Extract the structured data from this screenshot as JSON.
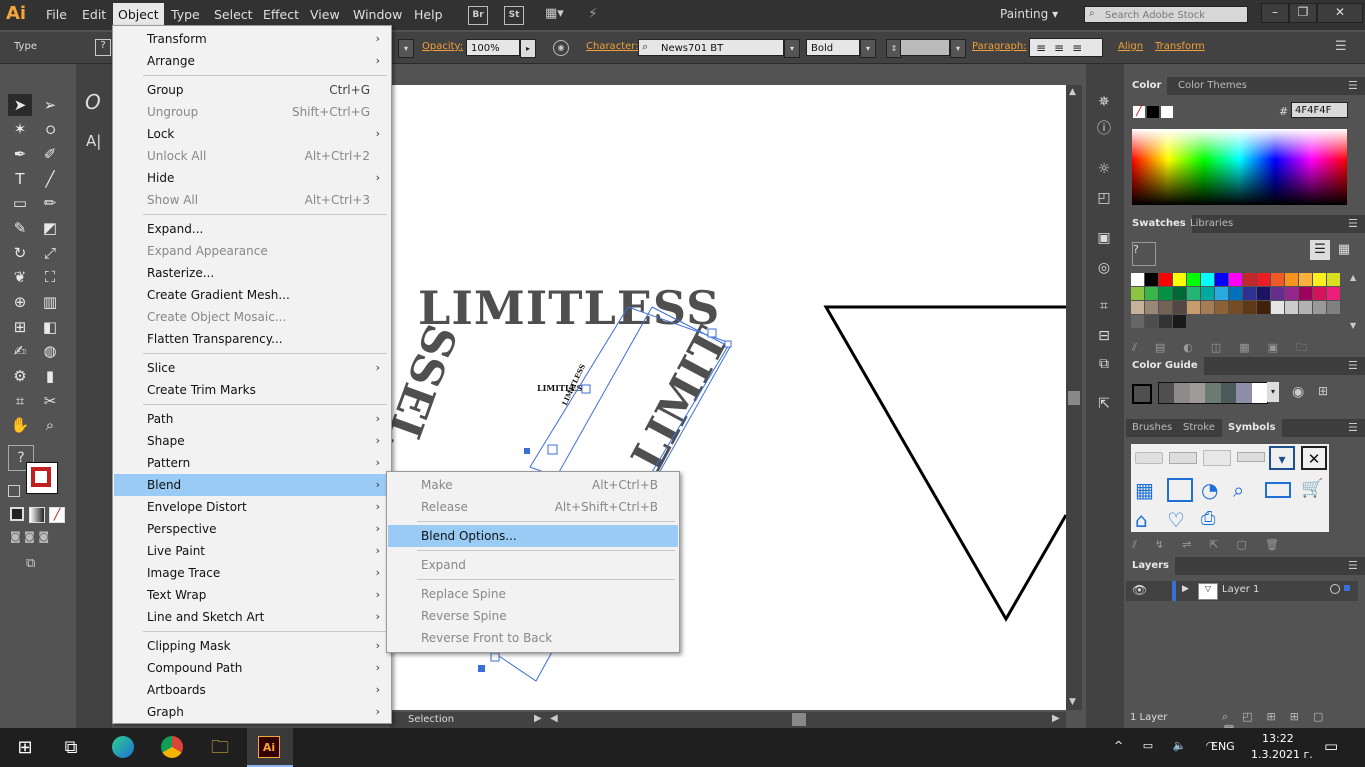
{
  "app": {
    "logo": "Ai",
    "workspace": "Painting",
    "search_placeholder": "Search Adobe Stock"
  },
  "menubar": [
    "File",
    "Edit",
    "Object",
    "Type",
    "Select",
    "Effect",
    "View",
    "Window",
    "Help"
  ],
  "menubar_icons": {
    "br": "Br",
    "st": "St"
  },
  "controlbar": {
    "tool_label": "Type",
    "opacity_label": "Opacity:",
    "opacity_value": "100%",
    "character_label": "Character:",
    "font_value": "News701 BT",
    "style_value": "Bold",
    "paragraph_label": "Paragraph:",
    "align_label": "Align",
    "transform_label": "Transform"
  },
  "object_menu": [
    {
      "label": "Transform",
      "submenu": true
    },
    {
      "label": "Arrange",
      "submenu": true
    },
    {
      "sep": true
    },
    {
      "label": "Group",
      "shortcut": "Ctrl+G"
    },
    {
      "label": "Ungroup",
      "shortcut": "Shift+Ctrl+G",
      "disabled": true
    },
    {
      "label": "Lock",
      "submenu": true
    },
    {
      "label": "Unlock All",
      "shortcut": "Alt+Ctrl+2",
      "disabled": true
    },
    {
      "label": "Hide",
      "submenu": true
    },
    {
      "label": "Show All",
      "shortcut": "Alt+Ctrl+3",
      "disabled": true
    },
    {
      "sep": true
    },
    {
      "label": "Expand..."
    },
    {
      "label": "Expand Appearance",
      "disabled": true
    },
    {
      "label": "Rasterize..."
    },
    {
      "label": "Create Gradient Mesh..."
    },
    {
      "label": "Create Object Mosaic...",
      "disabled": true
    },
    {
      "label": "Flatten Transparency..."
    },
    {
      "sep": true
    },
    {
      "label": "Slice",
      "submenu": true
    },
    {
      "label": "Create Trim Marks"
    },
    {
      "sep": true
    },
    {
      "label": "Path",
      "submenu": true
    },
    {
      "label": "Shape",
      "submenu": true
    },
    {
      "label": "Pattern",
      "submenu": true
    },
    {
      "label": "Blend",
      "submenu": true,
      "highlight": true
    },
    {
      "label": "Envelope Distort",
      "submenu": true
    },
    {
      "label": "Perspective",
      "submenu": true
    },
    {
      "label": "Live Paint",
      "submenu": true
    },
    {
      "label": "Image Trace",
      "submenu": true
    },
    {
      "label": "Text Wrap",
      "submenu": true
    },
    {
      "label": "Line and Sketch Art",
      "submenu": true
    },
    {
      "sep": true
    },
    {
      "label": "Clipping Mask",
      "submenu": true
    },
    {
      "label": "Compound Path",
      "submenu": true
    },
    {
      "label": "Artboards",
      "submenu": true
    },
    {
      "label": "Graph",
      "submenu": true
    }
  ],
  "blend_submenu": [
    {
      "label": "Make",
      "shortcut": "Alt+Ctrl+B",
      "disabled": true
    },
    {
      "label": "Release",
      "shortcut": "Alt+Shift+Ctrl+B",
      "disabled": true
    },
    {
      "sep": true
    },
    {
      "label": "Blend Options...",
      "highlight": true
    },
    {
      "sep": true
    },
    {
      "label": "Expand",
      "disabled": true
    },
    {
      "sep": true
    },
    {
      "label": "Replace Spine",
      "disabled": true
    },
    {
      "label": "Reverse Spine",
      "disabled": true
    },
    {
      "label": "Reverse Front to Back",
      "disabled": true
    }
  ],
  "artwork": {
    "text_main": "LIMITLESS",
    "text_rot_left": "SSEL",
    "text_rot_right": "LIMIT",
    "text_small": "LIMITLESS",
    "text_small_rot": "LIMITLESS"
  },
  "status": {
    "tool": "Selection"
  },
  "panels": {
    "color_tabs": [
      "Color",
      "Color Themes"
    ],
    "color_hex_label": "#",
    "color_hex": "4F4F4F",
    "swatch_tabs": [
      "Swatches",
      "Libraries"
    ],
    "color_guide_tab": "Color Guide",
    "symbol_tabs": [
      "Brushes",
      "Stroke",
      "Symbols"
    ],
    "layers_tab": "Layers",
    "layer_name": "Layer 1",
    "layers_count": "1 Layer"
  },
  "swatch_colors": [
    "#ffffff",
    "#000000",
    "#ff0000",
    "#ffff00",
    "#00ff00",
    "#00ffff",
    "#0000ff",
    "#ff00ff",
    "#c1272d",
    "#ed1c24",
    "#f15a24",
    "#f7931e",
    "#fbb03b",
    "#fcee21",
    "#d9e021",
    "#8cc63f",
    "#39b54a",
    "#009245",
    "#006837",
    "#22b573",
    "#00a99d",
    "#29abe2",
    "#0071bc",
    "#2e3192",
    "#1b1464",
    "#662d91",
    "#93278f",
    "#9e005d",
    "#d4145a",
    "#ed1e79",
    "#c7b299",
    "#998675",
    "#736357",
    "#534741",
    "#c69c6d",
    "#a67c52",
    "#8c6239",
    "#754c24",
    "#603813",
    "#42210b",
    "#e6e6e6",
    "#cccccc",
    "#b3b3b3",
    "#999999",
    "#808080",
    "#666666",
    "#4d4d4d",
    "#333333",
    "#1a1a1a"
  ],
  "color_guide_swatches": [
    "#4f4f4f",
    "#8e8a8a",
    "#a19a9a",
    "#6d7a73",
    "#4d5a5c",
    "#8c8fa6",
    "#ffffff"
  ],
  "taskbar": {
    "time": "13:22",
    "date": "1.3.2021 г.",
    "lang": "ENG"
  },
  "accent": "#99cbf5"
}
